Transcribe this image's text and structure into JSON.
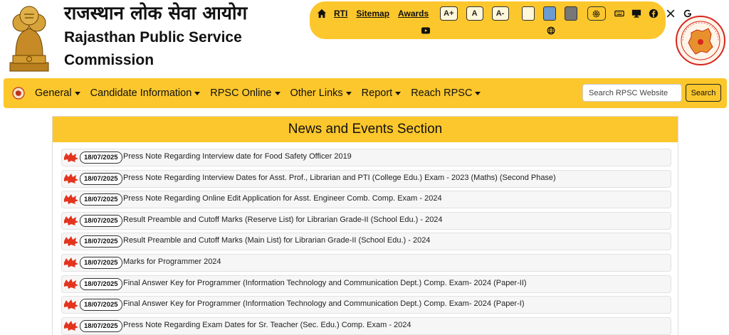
{
  "header": {
    "title_hindi": "राजस्थान लोक सेवा आयोग",
    "title_english_line1": "Rajasthan Public Service",
    "title_english_line2": "Commission"
  },
  "accessibility": {
    "links": [
      "RTI",
      "Sitemap",
      "Awards"
    ],
    "font_buttons": [
      "A+",
      "A",
      "A-"
    ],
    "swatches": [
      "#fff7d9",
      "#6b9bcf",
      "#777777"
    ],
    "social_icons": [
      "keyboard-icon",
      "monitor-icon",
      "facebook-icon",
      "x-twitter-icon",
      "google-icon",
      "youtube-icon",
      "globe-icon"
    ]
  },
  "nav": {
    "items": [
      "General",
      "Candidate Information",
      "RPSC Online",
      "Other Links",
      "Report",
      "Reach RPSC"
    ],
    "search_placeholder": "Search RPSC Website",
    "search_button": "Search"
  },
  "news": {
    "title": "News and Events Section",
    "items": [
      {
        "date": "18/07/2025",
        "text": "Press Note Regarding Interview date for Food Safety Officer 2019"
      },
      {
        "date": "18/07/2025",
        "text": "Press Note Regarding Interview Dates for Asst. Prof., Librarian and PTI (College Edu.) Exam - 2023 (Maths) (Second Phase)"
      },
      {
        "date": "18/07/2025",
        "text": "Press Note Regarding Online Edit Application for Asst. Engineer Comb. Comp. Exam - 2024"
      },
      {
        "date": "18/07/2025",
        "text": "Result Preamble and Cutoff Marks (Reserve List) for Librarian Grade-II (School Edu.) - 2024"
      },
      {
        "date": "18/07/2025",
        "text": "Result Preamble and Cutoff Marks (Main List) for Librarian Grade-II (School Edu.) - 2024"
      },
      {
        "date": "18/07/2025",
        "text": "Marks for Programmer 2024"
      },
      {
        "date": "18/07/2025",
        "text": "Final Answer Key for Programmer (Information Technology and Communication Dept.) Comp. Exam- 2024 (Paper-II)"
      },
      {
        "date": "18/07/2025",
        "text": "Final Answer Key for Programmer (Information Technology and Communication Dept.) Comp. Exam- 2024 (Paper-I)"
      },
      {
        "date": "18/07/2025",
        "text": "Press Note Regarding Exam Dates for Sr. Teacher (Sec. Edu.) Comp. Exam - 2024"
      }
    ]
  },
  "colors": {
    "accent": "#fcc72c"
  }
}
